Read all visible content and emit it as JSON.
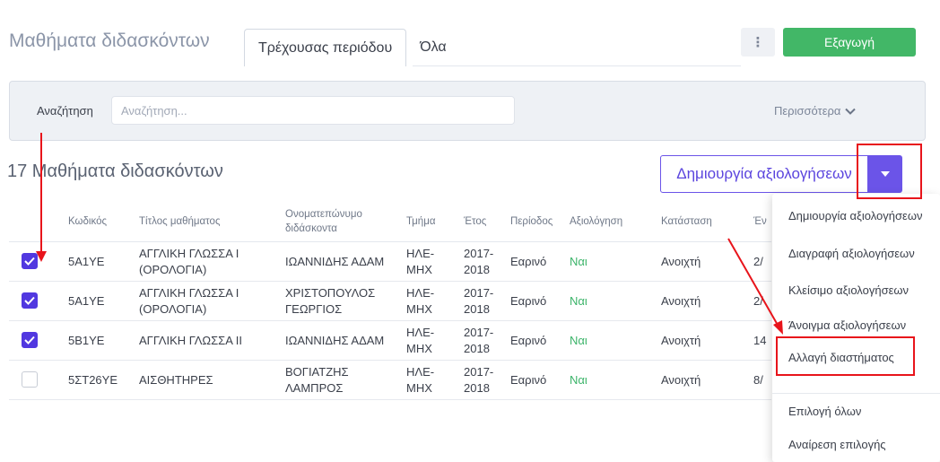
{
  "header": {
    "title": "Μαθήματα διδασκόντων",
    "tabs": [
      {
        "label": "Τρέχουσας περιόδου",
        "active": true
      },
      {
        "label": "Όλα",
        "active": false
      }
    ],
    "menu_glyph": "⋮",
    "export_label": "Εξαγωγή"
  },
  "search": {
    "label": "Αναζήτηση",
    "placeholder": "Αναζήτηση...",
    "more_label": "Περισσότερα"
  },
  "list": {
    "title": "17 Μαθήματα διδασκόντων",
    "create_label": "Δημιουργία αξιολογήσεων"
  },
  "table": {
    "headers": {
      "code": "Κωδικός",
      "title": "Τίτλος μαθήματος",
      "instructor": "Ονοματεπώνυμο διδάσκοντα",
      "department": "Τμήμα",
      "year": "Έτος",
      "period": "Περίοδος",
      "evaluation": "Αξιολόγηση",
      "status": "Κατάσταση",
      "extra": "Έν"
    },
    "rows": [
      {
        "checked": true,
        "code": "5A1YE",
        "title": "ΑΓΓΛΙΚΗ ΓΛΩΣΣΑ Ι (ΟΡΟΛΟΓΙΑ)",
        "instructor": "ΙΩΑΝΝΙΔΗΣ ΑΔΑΜ",
        "department": "ΗΛΕ-ΜΗΧ",
        "year": "2017-2018",
        "period": "Εαρινό",
        "evaluation": "Ναι",
        "status": "Ανοιχτή",
        "extra": "2/"
      },
      {
        "checked": true,
        "code": "5A1YE",
        "title": "ΑΓΓΛΙΚΗ ΓΛΩΣΣΑ Ι (ΟΡΟΛΟΓΙΑ)",
        "instructor": "ΧΡΙΣΤΟΠΟΥΛΟΣ ΓΕΩΡΓΙΟΣ",
        "department": "ΗΛΕ-ΜΗΧ",
        "year": "2017-2018",
        "period": "Εαρινό",
        "evaluation": "Ναι",
        "status": "Ανοιχτή",
        "extra": "2/"
      },
      {
        "checked": true,
        "code": "5B1YE",
        "title": "ΑΓΓΛΙΚΗ ΓΛΩΣΣΑ ΙΙ",
        "instructor": "ΙΩΑΝΝΙΔΗΣ ΑΔΑΜ",
        "department": "ΗΛΕ-ΜΗΧ",
        "year": "2017-2018",
        "period": "Εαρινό",
        "evaluation": "Ναι",
        "status": "Ανοιχτή",
        "extra": "14"
      },
      {
        "checked": false,
        "code": "5ΣΤ26YE",
        "title": "ΑΙΣΘΗΤΗΡΕΣ",
        "instructor": "ΒΟΓΙΑΤΖΗΣ ΛΑΜΠΡΟΣ",
        "department": "ΗΛΕ-ΜΗΧ",
        "year": "2017-2018",
        "period": "Εαρινό",
        "evaluation": "Ναι",
        "status": "Ανοιχτή",
        "extra": "8/"
      }
    ]
  },
  "dropdown": {
    "items": [
      "Δημιουργία αξιολογήσεων",
      "Διαγραφή αξιολογήσεων",
      "Κλείσιμο αξιολογήσεων",
      "Άνοιγμα αξιολογήσεων",
      "Αλλαγή διαστήματος",
      "Επιλογή όλων",
      "Αναίρεση επιλογής"
    ]
  },
  "colors": {
    "accent": "#6b54e8",
    "export": "#42b767",
    "annotation": "#e8141b",
    "yes": "#3cb46a"
  }
}
